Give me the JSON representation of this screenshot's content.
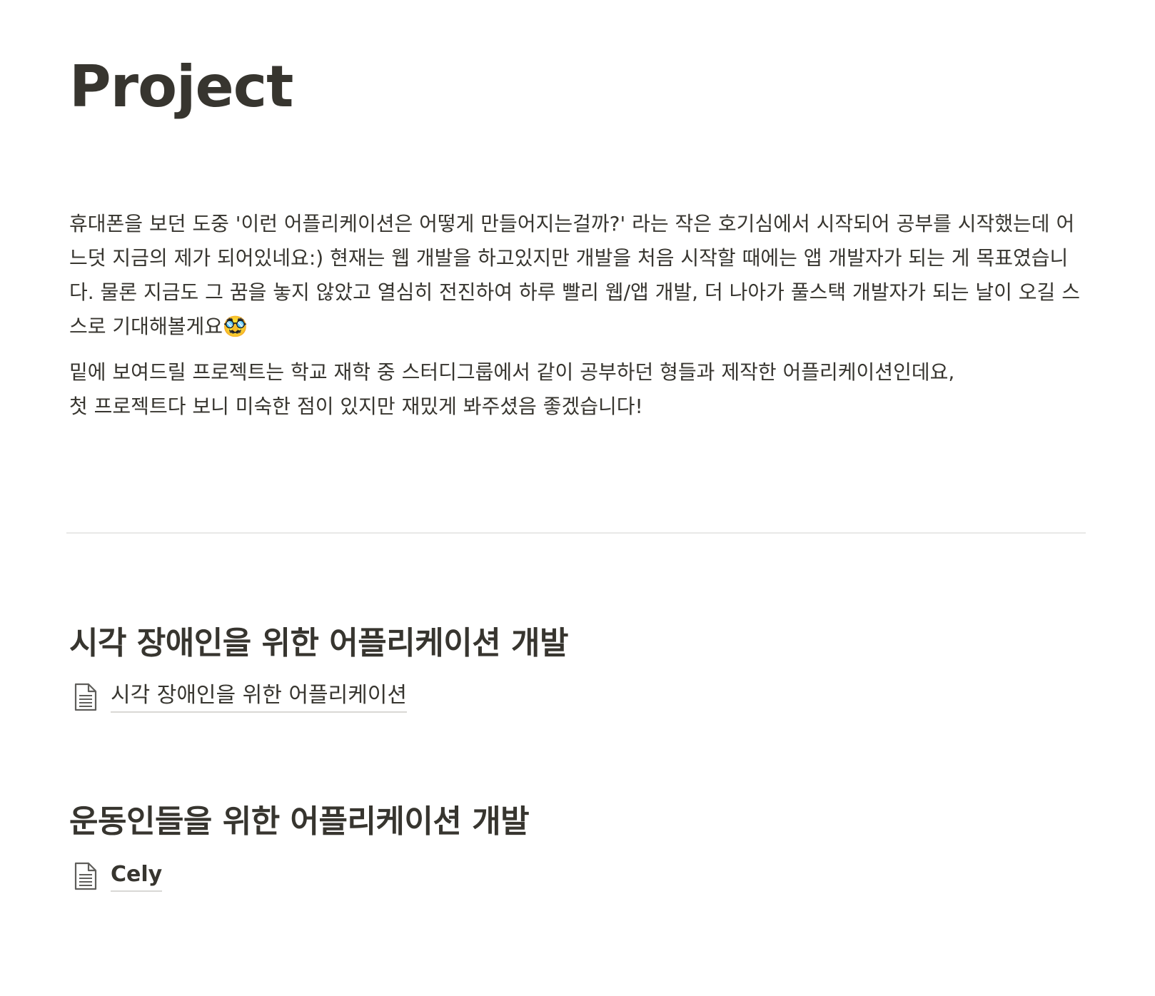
{
  "page": {
    "title": "Project"
  },
  "intro": {
    "paragraph1": "휴대폰을 보던 도중 '이런 어플리케이션은 어떻게 만들어지는걸까?' 라는 작은 호기심에서 시작되어 공부를 시작했는데 어느덧 지금의 제가 되어있네요:) 현재는 웹 개발을 하고있지만 개발을 처음 시작할 때에는 앱 개발자가 되는 게 목표였습니다. 물론 지금도 그 꿈을 놓지 않았고 열심히 전진하여 하루 빨리 웹/앱 개발, 더 나아가 풀스택 개발자가 되는 날이 오길 스스로 기대해볼게요🥸",
    "paragraph2_line1": "밑에 보여드릴 프로젝트는 학교 재학 중 스터디그룹에서 같이 공부하던 형들과 제작한 어플리케이션인데요,",
    "paragraph2_line2": "첫 프로젝트다 보니 미숙한 점이 있지만 재밌게 봐주셨음 좋겠습니다!"
  },
  "sections": [
    {
      "heading": "시각 장애인을 위한 어플리케이션 개발",
      "link_label": "시각 장애인을 위한 어플리케이션",
      "link_icon": "page-document-icon"
    },
    {
      "heading": "운동인들을 위한 어플리케이션 개발",
      "link_label": "Cely",
      "link_icon": "page-document-icon"
    }
  ],
  "colors": {
    "text": "#37352f",
    "divider": "#e9e9e7",
    "link_underline": "#d9d8d5"
  }
}
